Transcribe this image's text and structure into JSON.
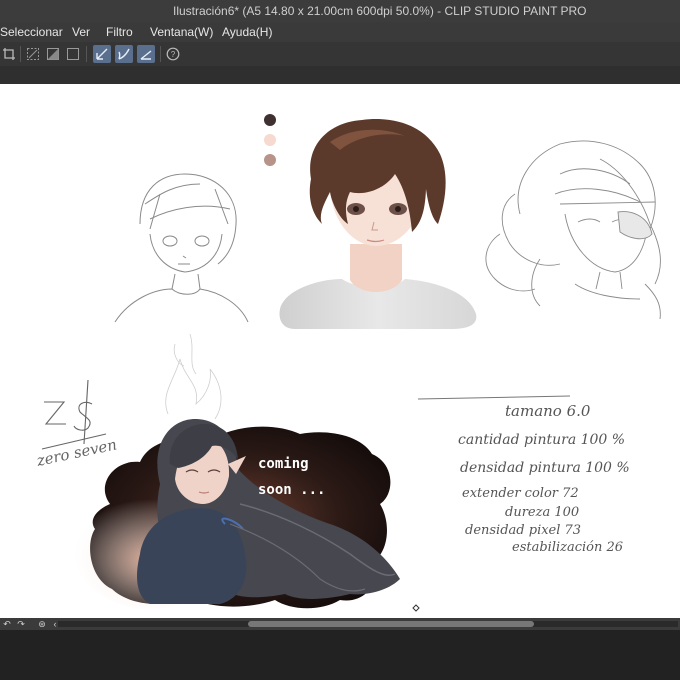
{
  "window": {
    "title": "Ilustración6* (A5 14.80 x 21.00cm 600dpi 50.0%)  - CLIP STUDIO PAINT PRO"
  },
  "menu": {
    "items": [
      "Seleccionar",
      "Ver",
      "Filtro",
      "Ventana(W)",
      "Ayuda(H)"
    ]
  },
  "canvas": {
    "logo_text": "ZS",
    "signature": "zero seven",
    "banner": [
      "coming",
      "soon ..."
    ],
    "notes": {
      "tamano": "tamano 6.0",
      "cantidad": "cantidad pintura 100 %",
      "densidad": "densidad pintura 100 %",
      "extender": "extender color  72",
      "dureza": "dureza  100",
      "pixel": "densidad pixel 73",
      "estabilizacion": "estabilización 26"
    },
    "palette": [
      "#3f3131",
      "#f6d9cf",
      "#b89389"
    ]
  },
  "icons": {
    "toolbar": [
      "crop-icon",
      "select-dotted-icon",
      "select-fill-icon",
      "select-box-icon",
      "pen-active-icon",
      "brush-active-icon",
      "line-active-icon",
      "help-icon"
    ],
    "statusbar": [
      "undo-icon",
      "redo-icon",
      "nav-down-icon",
      "nav-left-icon"
    ]
  }
}
